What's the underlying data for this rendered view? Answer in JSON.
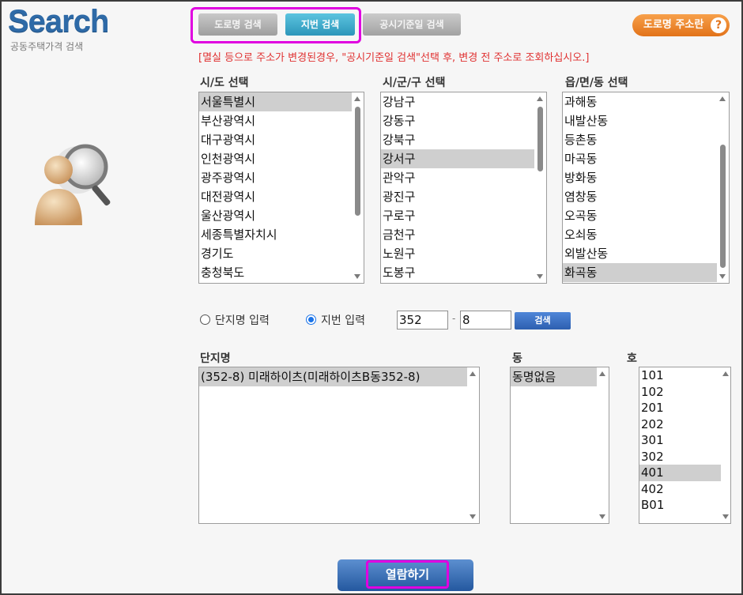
{
  "logo": {
    "title": "Search",
    "subtitle": "공동주택가격 검색"
  },
  "tabs": {
    "road": "도로명 검색",
    "lot": "지번 검색",
    "date": "공시기준일 검색"
  },
  "road_info_button": {
    "label": "도로명 주소란",
    "icon": "?"
  },
  "notice": "[멸실 등으로 주소가 변경된경우, \"공시기준일 검색\"선택 후, 변경 전 주소로 조회하십시오.]",
  "sido": {
    "label": "시/도 선택",
    "items": [
      "서울특별시",
      "부산광역시",
      "대구광역시",
      "인천광역시",
      "광주광역시",
      "대전광역시",
      "울산광역시",
      "세종특별자치시",
      "경기도",
      "충청북도"
    ],
    "selected": "서울특별시"
  },
  "sigungu": {
    "label": "시/군/구 선택",
    "items": [
      "강남구",
      "강동구",
      "강북구",
      "강서구",
      "관악구",
      "광진구",
      "구로구",
      "금천구",
      "노원구",
      "도봉구"
    ],
    "selected": "강서구"
  },
  "dong": {
    "label": "읍/면/동 선택",
    "items": [
      "과해동",
      "내발산동",
      "등촌동",
      "마곡동",
      "방화동",
      "염창동",
      "오곡동",
      "오쇠동",
      "외발산동",
      "화곡동"
    ],
    "selected": "화곡동"
  },
  "search_mode": {
    "complex_label": "단지명 입력",
    "lot_label": "지번 입력",
    "selected": "지번 입력",
    "main_number": "352",
    "dash": "-",
    "sub_number": "8",
    "search_button": "검색"
  },
  "complex": {
    "label": "단지명",
    "items": [
      "(352-8) 미래하이츠(미래하이츠B동352-8)"
    ],
    "selected": "(352-8) 미래하이츠(미래하이츠B동352-8)"
  },
  "building": {
    "label": "동",
    "items": [
      "동명없음"
    ],
    "selected": "동명없음"
  },
  "unit": {
    "label": "호",
    "items": [
      "101",
      "102",
      "201",
      "202",
      "301",
      "302",
      "401",
      "402",
      "B01"
    ],
    "selected": "401"
  },
  "view_button": "열람하기",
  "colors": {
    "accent_pink": "#e000e0",
    "notice_red": "#e03131",
    "tab_active": "#2d96ba",
    "logo_blue": "#2e6aa7"
  }
}
